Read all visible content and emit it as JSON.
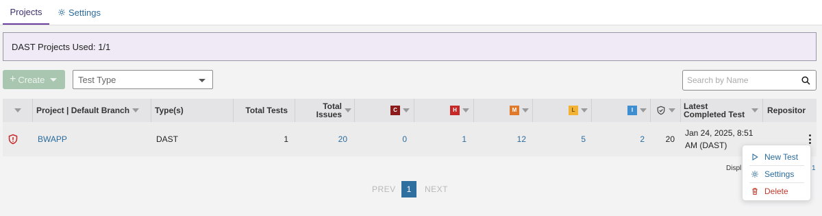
{
  "tabs": [
    {
      "label": "Projects",
      "active": true
    },
    {
      "label": "Settings",
      "active": false,
      "icon": "gear-icon"
    }
  ],
  "quota_text": "DAST Projects Used: 1/1",
  "toolbar": {
    "create_label": "Create",
    "test_type_placeholder": "Test Type",
    "search_placeholder": "Search by Name"
  },
  "table": {
    "headers": {
      "project": "Project | Default Branch",
      "types": "Type(s)",
      "total_tests": "Total Tests",
      "total_issues_1": "Total",
      "total_issues_2": "Issues",
      "critical": "C",
      "high": "H",
      "medium": "M",
      "low": "L",
      "info": "I",
      "latest_1": "Latest",
      "latest_2": "Completed Test",
      "repository": "Repositor"
    },
    "severity_colors": {
      "critical": "#8b1a1a",
      "high": "#c62828",
      "medium": "#e07a2a",
      "low": "#f2b233",
      "info": "#3f8fd0"
    },
    "rows": [
      {
        "status_icon": "shield-alert-icon",
        "project": "BWAPP",
        "types": "DAST",
        "total_tests": "1",
        "total_issues": "20",
        "critical": "0",
        "high": "1",
        "medium": "12",
        "low": "5",
        "info": "2",
        "verified": "20",
        "latest_1": "Jan 24, 2025, 8:51",
        "latest_2": "AM (DAST)"
      }
    ]
  },
  "row_menu": {
    "items": [
      {
        "label": "New Test",
        "icon": "play-icon"
      },
      {
        "label": "Settings",
        "icon": "gear-icon"
      },
      {
        "label": "Delete",
        "icon": "trash-icon"
      }
    ]
  },
  "display_text": "Displ",
  "display_num": "1",
  "pagination": {
    "prev": "PREV",
    "current": "1",
    "next": "NEXT"
  }
}
